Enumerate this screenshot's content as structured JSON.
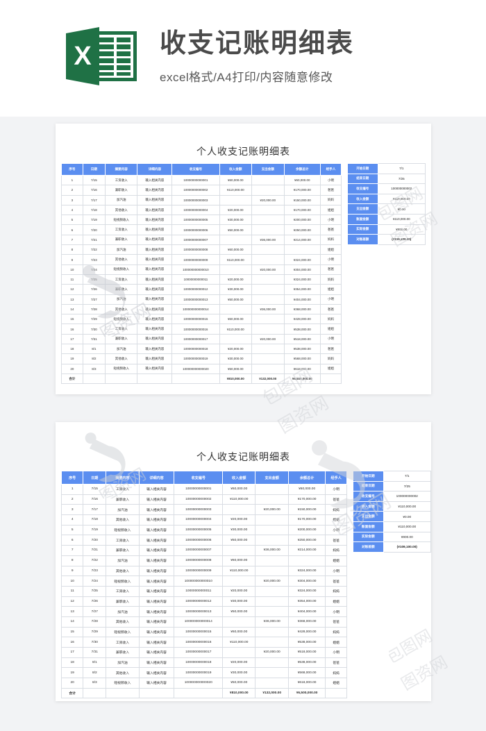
{
  "banner": {
    "logo_letter": "X",
    "title": "收支记账明细表",
    "subtitle": "excel格式/A4打印/内容随意修改",
    "logo_color": "#217346"
  },
  "sheet": {
    "title": "个人收支记账明细表",
    "header_color": "#5b8ef0",
    "negative_color": "#e8121a",
    "columns": [
      "序号",
      "日期",
      "摘要内容",
      "详细内容",
      "收支编号",
      "收入金额",
      "支出金额",
      "余额总计",
      "经手人"
    ],
    "rows": [
      [
        "1",
        "7/15",
        "工资收入",
        "输入相关内容",
        "10000000000001",
        "¥60,000.00",
        "",
        "¥60,000.00",
        "小明"
      ],
      [
        "2",
        "7/16",
        "兼职收入",
        "输入相关内容",
        "10000000000002",
        "¥110,000.00",
        "",
        "¥170,000.00",
        "爸爸"
      ],
      [
        "3",
        "7/17",
        "加汽油",
        "输入相关内容",
        "10000000000003",
        "",
        "¥20,000.00",
        "¥150,000.00",
        "妈妈"
      ],
      [
        "4",
        "7/18",
        "其他收入",
        "输入相关内容",
        "10000000000004",
        "¥20,000.00",
        "",
        "¥170,000.00",
        "姐姐"
      ],
      [
        "5",
        "7/19",
        "短视频收入",
        "输入相关内容",
        "10000000000005",
        "¥30,000.00",
        "",
        "¥200,000.00",
        "小明"
      ],
      [
        "6",
        "7/20",
        "工资收入",
        "输入相关内容",
        "10000000000006",
        "¥50,000.00",
        "",
        "¥250,000.00",
        "爸爸"
      ],
      [
        "7",
        "7/21",
        "兼职收入",
        "输入相关内容",
        "10000000000007",
        "",
        "¥36,000.00",
        "¥214,000.00",
        "妈妈"
      ],
      [
        "8",
        "7/22",
        "加汽油",
        "输入相关内容",
        "10000000000008",
        "¥60,000.00",
        "",
        "",
        "姐姐"
      ],
      [
        "9",
        "7/23",
        "其他收入",
        "输入相关内容",
        "10000000000009",
        "¥110,000.00",
        "",
        "¥324,000.00",
        "小明"
      ],
      [
        "10",
        "7/24",
        "短视频收入",
        "输入相关内容",
        "100000000000010",
        "",
        "¥20,000.00",
        "¥304,000.00",
        "爸爸"
      ],
      [
        "11",
        "7/25",
        "工资收入",
        "输入相关内容",
        "10000000000011",
        "¥20,000.00",
        "",
        "¥324,000.00",
        "妈妈"
      ],
      [
        "12",
        "7/26",
        "兼职收入",
        "输入相关内容",
        "10000000000012",
        "¥30,000.00",
        "",
        "¥354,000.00",
        "姐姐"
      ],
      [
        "13",
        "7/27",
        "加汽油",
        "输入相关内容",
        "10000000000013",
        "¥50,000.00",
        "",
        "¥404,000.00",
        "小明"
      ],
      [
        "14",
        "7/28",
        "其他收入",
        "输入相关内容",
        "100000000000014",
        "",
        "¥36,000.00",
        "¥368,000.00",
        "爸爸"
      ],
      [
        "15",
        "7/29",
        "短视频收入",
        "输入相关内容",
        "10000000000015",
        "¥60,000.00",
        "",
        "¥428,000.00",
        "妈妈"
      ],
      [
        "16",
        "7/30",
        "工资收入",
        "输入相关内容",
        "10000000000016",
        "¥110,000.00",
        "",
        "¥538,000.00",
        "姐姐"
      ],
      [
        "17",
        "7/31",
        "兼职收入",
        "输入相关内容",
        "10000000000017",
        "",
        "¥20,000.00",
        "¥518,000.00",
        "小明"
      ],
      [
        "18",
        "8/1",
        "加汽油",
        "输入相关内容",
        "10000000000018",
        "¥20,000.00",
        "",
        "¥538,000.00",
        "爸爸"
      ],
      [
        "19",
        "8/2",
        "其他收入",
        "输入相关内容",
        "10000000000019",
        "¥30,000.00",
        "",
        "¥568,000.00",
        "妈妈"
      ],
      [
        "20",
        "8/3",
        "短视频收入",
        "输入相关内容",
        "100000000000020",
        "¥50,000.00",
        "",
        "¥618,000.00",
        "姐姐"
      ]
    ],
    "total_row": {
      "label": "合计",
      "income": "¥810,000.00",
      "expense": "¥132,000.00",
      "balance": "¥6,500,000.00"
    }
  },
  "summary": {
    "items": [
      {
        "label": "开始日期",
        "value": "7/1",
        "negative": false
      },
      {
        "label": "结束日期",
        "value": "7/25",
        "negative": false
      },
      {
        "label": "收支编号",
        "value": "100000000002",
        "negative": false
      },
      {
        "label": "收入金额",
        "value": "¥110,000.00",
        "negative": false
      },
      {
        "label": "支出金额",
        "value": "¥0.00",
        "negative": false
      },
      {
        "label": "账面金额",
        "value": "¥110,000.00",
        "negative": false
      },
      {
        "label": "实际金额",
        "value": "¥900.00",
        "negative": false
      },
      {
        "label": "对账差额",
        "value": "(¥109,100.00)",
        "negative": true
      }
    ]
  }
}
